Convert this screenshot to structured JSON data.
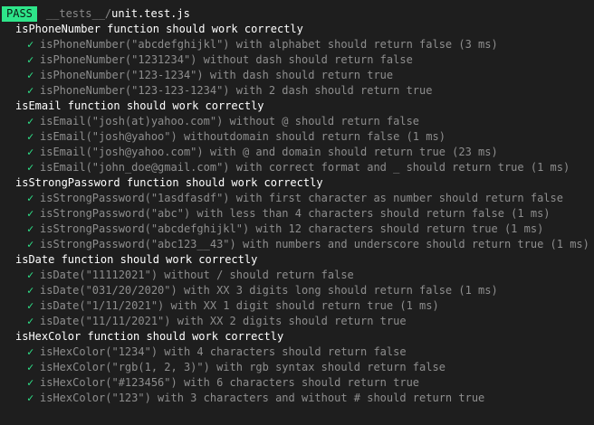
{
  "header": {
    "status": "PASS",
    "file_dir": "__tests__/",
    "file_name": "unit.test.js"
  },
  "check_icon": "✓",
  "colors": {
    "pass_badge": "#2ee58a",
    "check": "#2ee58a",
    "background": "#1e1e1e",
    "muted_text": "#8e8e8e"
  },
  "suites": [
    {
      "title": "isPhoneNumber function should work correctly",
      "tests": [
        "isPhoneNumber(\"abcdefghijkl\") with alphabet should return false (3 ms)",
        "isPhoneNumber(\"1231234\") without dash should return false",
        "isPhoneNumber(\"123-1234\") with dash should return true",
        "isPhoneNumber(\"123-123-1234\") with 2 dash should return true"
      ]
    },
    {
      "title": "isEmail function should work correctly",
      "tests": [
        "isEmail(\"josh(at)yahoo.com\") without @ should return false",
        "isEmail(\"josh@yahoo\") withoutdomain should return false (1 ms)",
        "isEmail(\"josh@yahoo.com\") with @ and domain should return true (23 ms)",
        "isEmail(\"john_doe@gmail.com\") with correct format and _ should return true (1 ms)"
      ]
    },
    {
      "title": "isStrongPassword function should work correctly",
      "tests": [
        "isStrongPassword(\"1asdfasdf\") with first character as number should return false",
        "isStrongPassword(\"abc\") with less than 4 characters should return false (1 ms)",
        "isStrongPassword(\"abcdefghijkl\") with 12 characters should return true (1 ms)",
        "isStrongPassword(\"abc123__43\") with numbers and underscore should return true (1 ms)"
      ]
    },
    {
      "title": "isDate function should work correctly",
      "tests": [
        "isDate(\"11112021\") without / should return false",
        "isDate(\"031/20/2020\") with XX 3 digits long should return false (1 ms)",
        "isDate(\"1/11/2021\") with XX 1 digit should return true (1 ms)",
        "isDate(\"11/11/2021\") with XX 2 digits should return true"
      ]
    },
    {
      "title": "isHexColor function should work correctly",
      "tests": [
        "isHexColor(\"1234\") with 4 characters should return false",
        "isHexColor(\"rgb(1, 2, 3)\") with rgb syntax should return false",
        "isHexColor(\"#123456\") with 6 characters should return true",
        "isHexColor(\"123\") with 3 characters and without # should return true"
      ]
    }
  ]
}
